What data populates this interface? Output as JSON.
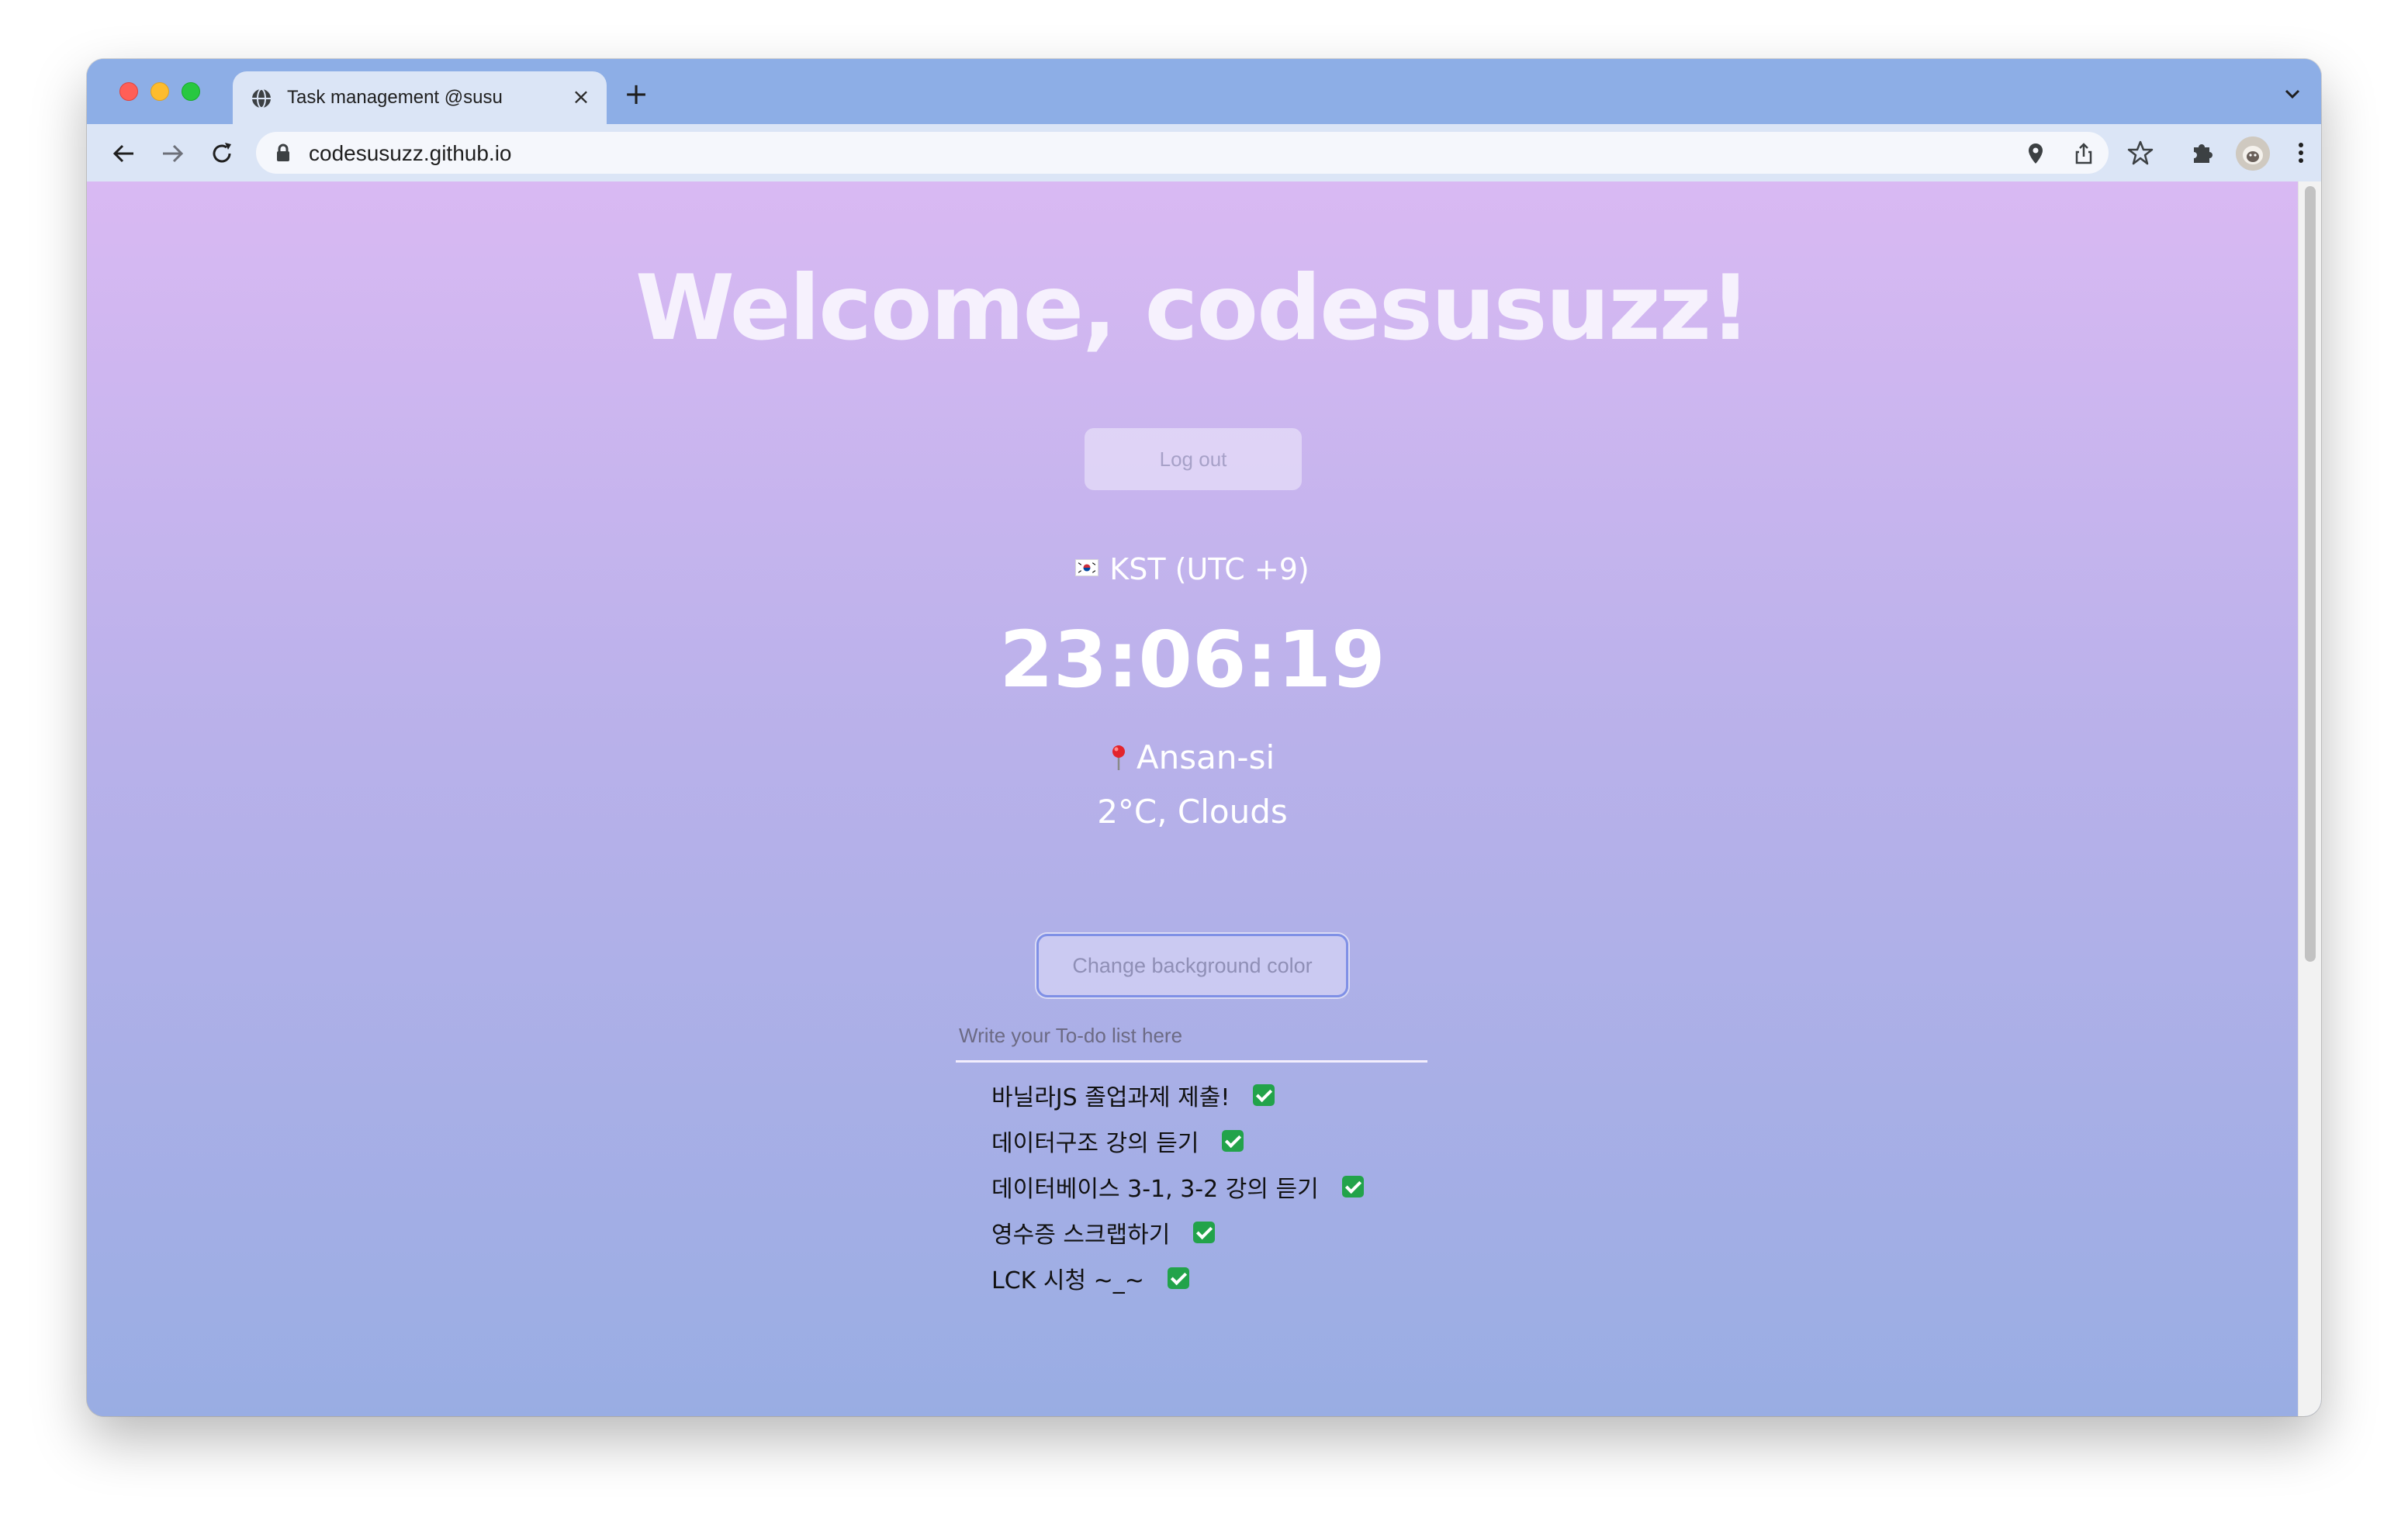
{
  "browser": {
    "tab_title": "Task management @susu",
    "tab_close": "×",
    "new_tab": "+",
    "url": "codesusuzz.github.io"
  },
  "page": {
    "welcome": "Welcome, codesusuzz!",
    "logout_label": "Log out",
    "timezone": "KST (UTC +9)",
    "clock": "23:06:19",
    "location": "Ansan-si",
    "weather": "2°C, Clouds",
    "change_bg_label": "Change background color",
    "todo_placeholder": "Write your To-do list here",
    "todos": [
      "바닐라JS 졸업과제 제출!",
      "데이터구조 강의 듣기",
      "데이터베이스 3-1, 3-2 강의 듣기",
      "영수증 스크랩하기",
      "LCK 시청 ~_~"
    ]
  },
  "colors": {
    "gradient_top": "#d9b9f3",
    "gradient_bottom": "#99ade3",
    "browser_frame": "#8daee6",
    "check": "#22a34a"
  },
  "icons": [
    "globe-icon",
    "close-icon",
    "plus-icon",
    "chevron-down-icon",
    "back-arrow-icon",
    "forward-arrow-icon",
    "reload-icon",
    "lock-icon",
    "location-icon",
    "share-icon",
    "star-icon",
    "extensions-icon",
    "kebab-menu-icon",
    "korea-flag-icon",
    "pin-icon",
    "check-icon"
  ]
}
